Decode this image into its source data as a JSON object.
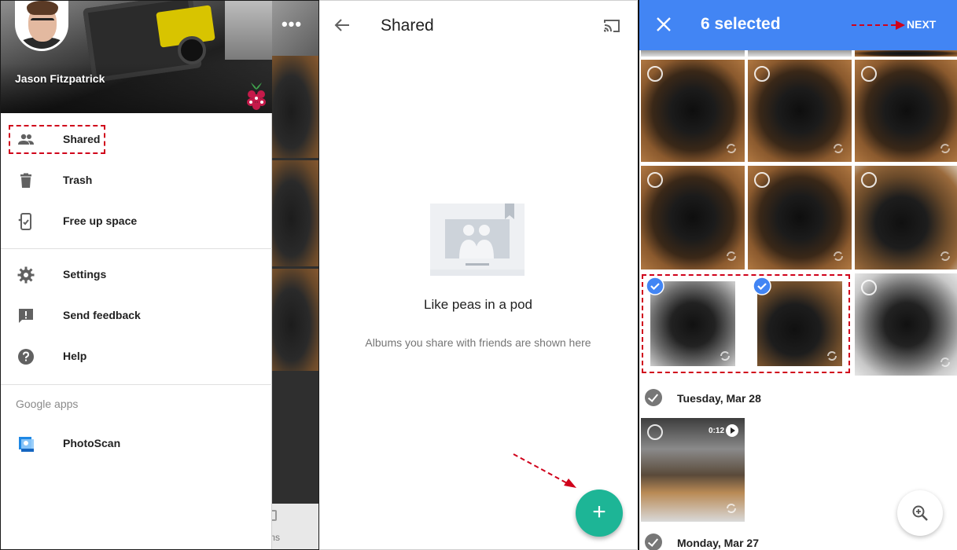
{
  "drawer": {
    "profile_name": "Jason Fitzpatrick",
    "menu": [
      {
        "label": "Shared",
        "icon": "people-icon"
      },
      {
        "label": "Trash",
        "icon": "trash-icon"
      },
      {
        "label": "Free up space",
        "icon": "free-up-space-icon"
      },
      {
        "label": "Settings",
        "icon": "gear-icon"
      },
      {
        "label": "Send feedback",
        "icon": "feedback-icon"
      },
      {
        "label": "Help",
        "icon": "help-icon"
      }
    ],
    "section_label": "Google apps",
    "apps": [
      {
        "label": "PhotoScan",
        "icon": "photoscan-icon"
      }
    ],
    "background_partial_text": "ms"
  },
  "shared": {
    "title": "Shared",
    "empty_title": "Like peas in a pod",
    "empty_subtitle": "Albums you share with friends are shown here",
    "fab_label": "+"
  },
  "selection": {
    "count_label": "6 selected",
    "next_label": "NEXT",
    "days": [
      {
        "label": "Tuesday, Mar 28"
      },
      {
        "label": "Monday, Mar 27"
      }
    ],
    "video_duration": "0:12"
  },
  "colors": {
    "accent_blue": "#4285f4",
    "fab_teal": "#1db596",
    "annotation_red": "#d0021b"
  }
}
